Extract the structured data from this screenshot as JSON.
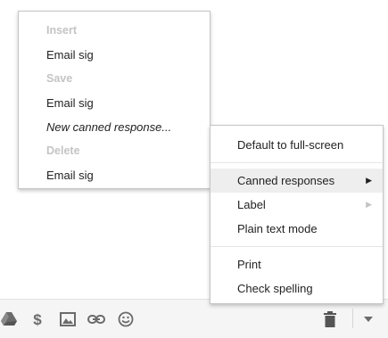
{
  "submenu": {
    "insert_header": "Insert",
    "insert_item": "Email sig",
    "save_header": "Save",
    "save_item": "Email sig",
    "new_canned": "New canned response...",
    "delete_header": "Delete",
    "delete_item": "Email sig"
  },
  "menu": {
    "default_full_screen": "Default to full-screen",
    "canned_responses": "Canned responses",
    "label": "Label",
    "plain_text": "Plain text mode",
    "print": "Print",
    "check_spelling": "Check spelling"
  },
  "toolbar": {
    "icons": [
      "drive-icon",
      "dollar-icon",
      "photo-icon",
      "link-icon",
      "emoji-icon",
      "trash-icon",
      "more-options-icon"
    ]
  },
  "colors": {
    "section_header": "#c4c4c4",
    "highlight": "#eeeeee",
    "toolbar_bg": "#f5f5f5",
    "icon": "#6b6b6b"
  }
}
